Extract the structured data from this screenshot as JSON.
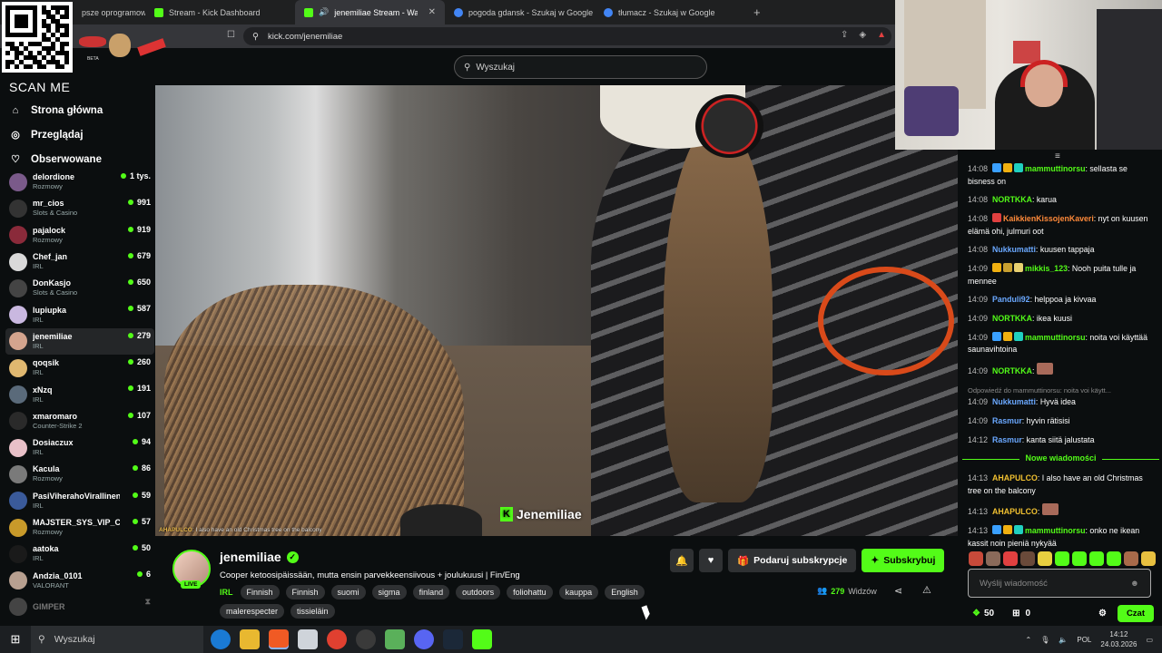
{
  "browser": {
    "tabs": [
      {
        "label": "psze oprogramowan",
        "color": "#888888"
      },
      {
        "label": "Stream - Kick Dashboard",
        "color": "#53fc18"
      },
      {
        "label": "jenemiliae Stream - Watch Liv",
        "color": "#53fc18"
      },
      {
        "label": "pogoda gdansk - Szukaj w Google",
        "color": "#4285f4"
      },
      {
        "label": "tłumacz - Szukaj w Google",
        "color": "#4285f4"
      }
    ],
    "url": "kick.com/jenemiliae"
  },
  "overlay": {
    "scan_label": "SCAN ME",
    "beta": "BETA"
  },
  "kick": {
    "search_placeholder": "Wyszukaj",
    "nav": [
      {
        "icon": "home-icon",
        "label": "Strona główna"
      },
      {
        "icon": "compass-icon",
        "label": "Przeglądaj"
      },
      {
        "icon": "heart-icon",
        "label": "Obserwowane"
      }
    ],
    "channels": [
      {
        "name": "delordione",
        "category": "Rozmowy",
        "viewers": "1 tys.",
        "color": "#7a5a8a"
      },
      {
        "name": "mr_cios",
        "category": "Slots & Casino",
        "viewers": "991",
        "color": "#333333"
      },
      {
        "name": "pajalock",
        "category": "Rozmowy",
        "viewers": "919",
        "color": "#8a2a3a"
      },
      {
        "name": "Chef_jan",
        "category": "IRL",
        "viewers": "679",
        "color": "#d9d9d9"
      },
      {
        "name": "DonKasjo",
        "category": "Slots & Casino",
        "viewers": "650",
        "color": "#444444"
      },
      {
        "name": "lupiupka",
        "category": "IRL",
        "viewers": "587",
        "color": "#c9b8e0"
      },
      {
        "name": "jenemiliae",
        "category": "IRL",
        "viewers": "279",
        "color": "#d4a48e"
      },
      {
        "name": "qoqsik",
        "category": "IRL",
        "viewers": "260",
        "color": "#e0b870"
      },
      {
        "name": "xNzq",
        "category": "IRL",
        "viewers": "191",
        "color": "#5a6a7a"
      },
      {
        "name": "xmaromaro",
        "category": "Counter-Strike 2",
        "viewers": "107",
        "color": "#2a2a2a"
      },
      {
        "name": "Dosiaczux",
        "category": "IRL",
        "viewers": "94",
        "color": "#e8c0c8"
      },
      {
        "name": "Kacula",
        "category": "Rozmowy",
        "viewers": "86",
        "color": "#7a7a7a"
      },
      {
        "name": "PasiViherahoVirallinen",
        "category": "IRL",
        "viewers": "59",
        "color": "#3a5a9a"
      },
      {
        "name": "MAJSTER_SYS_VIP_C",
        "category": "Rozmowy",
        "viewers": "57",
        "color": "#c89a2a"
      },
      {
        "name": "aatoka",
        "category": "IRL",
        "viewers": "50",
        "color": "#1a1a1a"
      },
      {
        "name": "Andzia_0101",
        "category": "VALORANT",
        "viewers": "6",
        "color": "#b8a090"
      },
      {
        "name": "GIMPER",
        "category": "",
        "viewers": "",
        "color": "#444444"
      }
    ],
    "video": {
      "caption_user": "AHAPULCO",
      "caption_text": ": I also have an old Christmas tree on the balcony",
      "watermark": "Jenemiliae",
      "k": "K"
    },
    "stream": {
      "live": "LIVE",
      "channel": "jenemiliae",
      "title": "Cooper ketoosipäissään, mutta ensin parvekkeensiivous + joulukuusi | Fin/Eng",
      "category": "IRL",
      "tags": [
        "Finnish",
        "Finnish",
        "suomi",
        "sigma",
        "finland",
        "outdoors",
        "foliohattu",
        "kauppa",
        "English",
        "malerespecter",
        "tissieläin"
      ],
      "gift_label": "Podaruj subskrypcje",
      "sub_label": "Subskrybuj",
      "viewer_count": "279",
      "viewer_label": "Widzów"
    }
  },
  "chat": {
    "messages": [
      {
        "time": "14:08",
        "user": "mammuttinorsu",
        "color": "#53fc18",
        "badges": [
          "#3aa0ff",
          "#f0b010",
          "#20d0c0"
        ],
        "text": "sellasta se bisness on"
      },
      {
        "time": "14:08",
        "user": "NORTKKA",
        "color": "#53fc18",
        "badges": [],
        "text": "karua"
      },
      {
        "time": "14:08",
        "user": "KaikkienKissojenKaveri",
        "color": "#ff8a3a",
        "badges": [
          "#e04040"
        ],
        "text": "nyt on kuusen elämä ohi, julmuri oot"
      },
      {
        "time": "14:08",
        "user": "Nukkumatti",
        "color": "#6aa8ff",
        "badges": [],
        "text": "kuusen tappaja"
      },
      {
        "time": "14:09",
        "user": "mikkis_123",
        "color": "#53fc18",
        "badges": [
          "#f0b010",
          "#c8a030",
          "#e8d070"
        ],
        "text": "Nooh puita tulle ja mennee"
      },
      {
        "time": "14:09",
        "user": "Panduli92",
        "color": "#6aa8ff",
        "badges": [],
        "text": "helppoa ja kivvaa"
      },
      {
        "time": "14:09",
        "user": "NORTKKA",
        "color": "#53fc18",
        "badges": [],
        "text": "ikea kuusi"
      },
      {
        "time": "14:09",
        "user": "mammuttinorsu",
        "color": "#53fc18",
        "badges": [
          "#3aa0ff",
          "#f0b010",
          "#20d0c0"
        ],
        "text": "noita voi käyttää saunavihtoina"
      },
      {
        "time": "14:09",
        "user": "NORTKKA",
        "color": "#53fc18",
        "badges": [],
        "text": ""
      },
      {
        "time": "14:09",
        "user": "Nukkumatti",
        "color": "#6aa8ff",
        "badges": [],
        "text": "Hyvä idea",
        "reply": "Odpowiedź do mammuttinorsu: noita voi käytt..."
      },
      {
        "time": "14:09",
        "user": "Rasmur",
        "color": "#6aa8ff",
        "badges": [],
        "text": "hyvin rätisisi"
      },
      {
        "time": "14:12",
        "user": "Rasmur",
        "color": "#6aa8ff",
        "badges": [],
        "text": "kanta siitä jalustata"
      }
    ],
    "new_messages_label": "Nowe wiadomości",
    "new_messages": [
      {
        "time": "14:13",
        "user": "AHAPULCO",
        "color": "#f0c030",
        "badges": [],
        "text": "I also have an old Christmas tree on the balcony"
      },
      {
        "time": "14:13",
        "user": "AHAPULCO",
        "color": "#f0c030",
        "badges": [],
        "text": ""
      },
      {
        "time": "14:13",
        "user": "mammuttinorsu",
        "color": "#53fc18",
        "badges": [
          "#3aa0ff",
          "#f0b010",
          "#20d0c0"
        ],
        "text": "onko ne ikean kassit noin pieniä nykyää"
      }
    ],
    "input_placeholder": "Wyślij wiadomość",
    "points": "50",
    "gifts": "0",
    "send_label": "Czat"
  },
  "taskbar": {
    "search_label": "Wyszukaj",
    "lang": "POL",
    "time": "14:12",
    "date": "24.03.2026"
  }
}
